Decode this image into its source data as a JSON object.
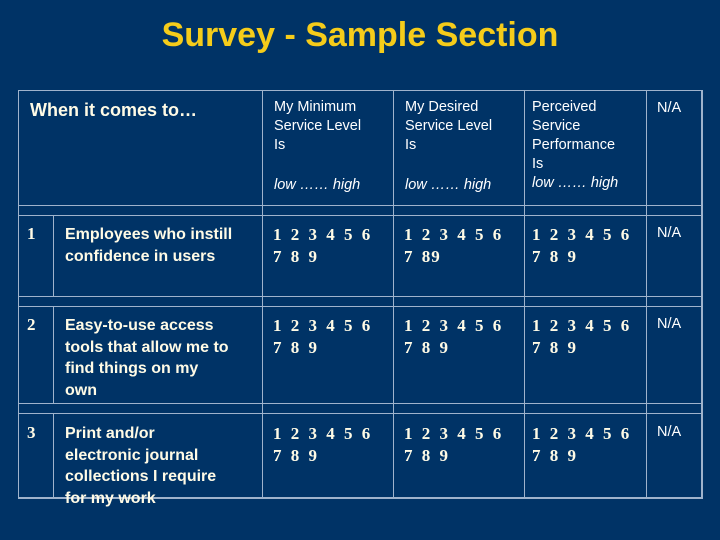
{
  "title": "Survey - Sample Section",
  "colors": {
    "background": "#003366",
    "title": "#f5cc1a",
    "grid": "#9fb3cc",
    "text": "#ffffff"
  },
  "table": {
    "header": {
      "when": "When it comes to…",
      "min_label": "My Minimum Service Level Is",
      "min_lines": [
        "My Minimum",
        "Service Level",
        "Is"
      ],
      "desired_lines": [
        "My Desired",
        "Service Level",
        "Is"
      ],
      "perceived_lines": [
        "Perceived",
        "Service",
        "Performance",
        "Is"
      ],
      "scale_label": "low …… high",
      "na": "N/A"
    },
    "rows": [
      {
        "num": "1",
        "desc_lines": [
          "Employees who instill",
          "confidence in users"
        ],
        "min_scale": [
          "1 2 3 4 5 6",
          "7 8 9"
        ],
        "desired_scale": [
          "1 2  3 4 5 6",
          "7 89"
        ],
        "perceived_scale": [
          "1 2 3 4 5 6",
          "7 8 9"
        ],
        "na": "N/A"
      },
      {
        "num": "2",
        "desc_lines": [
          "Easy-to-use access",
          "tools that allow me to",
          "find things on my",
          "own"
        ],
        "min_scale": [
          "1 2 3 4 5 6",
          "7 8 9"
        ],
        "desired_scale": [
          "1 2  3 4 5 6",
          "7 8 9"
        ],
        "perceived_scale": [
          "1 2 3 4 5 6",
          "7 8 9"
        ],
        "na": "N/A"
      },
      {
        "num": "3",
        "desc_lines": [
          "Print and/or",
          "electronic journal",
          "collections I require",
          "for my work"
        ],
        "min_scale": [
          "1 2 3 4 5 6",
          "7 8 9"
        ],
        "desired_scale": [
          "1 2 3 4 5 6",
          "7 8 9"
        ],
        "perceived_scale": [
          "1 2 3 4 5 6",
          "7 8 9"
        ],
        "na": "N/A"
      }
    ]
  }
}
